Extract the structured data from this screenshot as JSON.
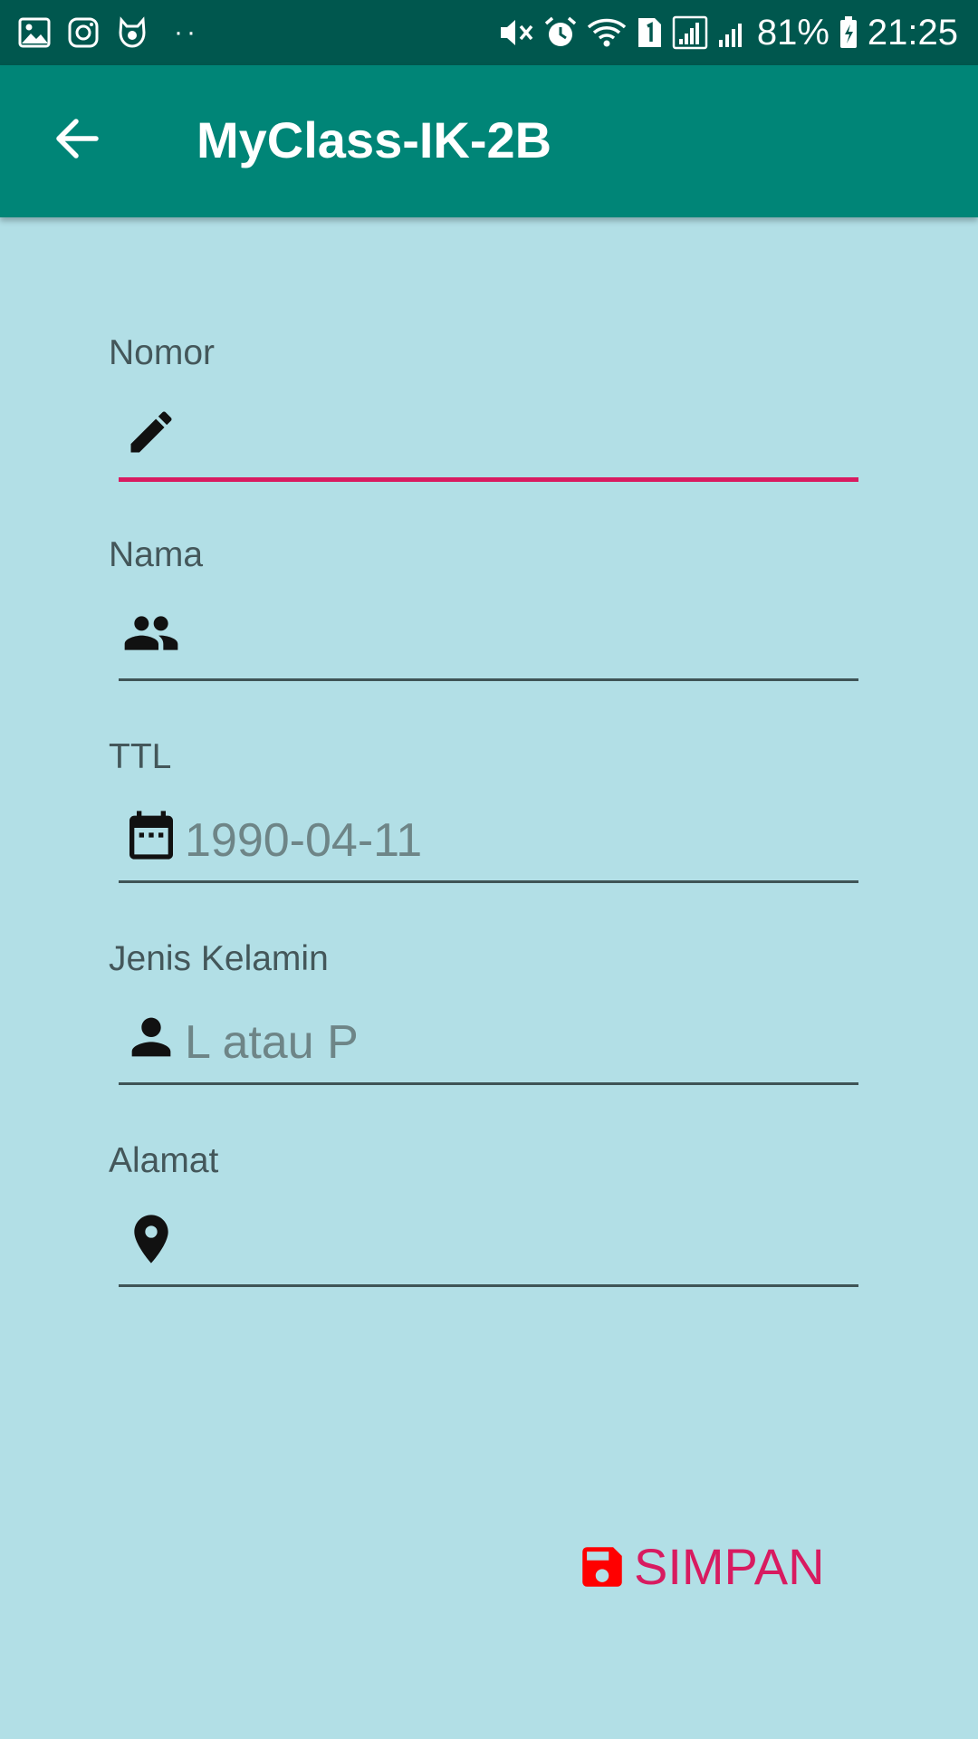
{
  "status_bar": {
    "left_icons": [
      "gallery-icon",
      "instagram-icon",
      "cat-app-icon"
    ],
    "dots": "··",
    "right_icons": [
      "mute-icon",
      "alarm-icon",
      "wifi-icon",
      "sim-1-icon",
      "signal-icon",
      "signal-icon-2",
      "battery-charging-icon"
    ],
    "battery_percent": "81%",
    "time": "21:25"
  },
  "app_bar": {
    "title": "MyClass-IK-2B",
    "background": "#008577",
    "back_icon": "arrow-back-icon"
  },
  "form": {
    "fields": [
      {
        "label": "Nomor",
        "icon": "pencil-icon",
        "value": "",
        "placeholder": "",
        "focused": true
      },
      {
        "label": "Nama",
        "icon": "people-icon",
        "value": "",
        "placeholder": ""
      },
      {
        "label": "TTL",
        "icon": "calendar-icon",
        "value": "",
        "placeholder": "1990-04-11"
      },
      {
        "label": "Jenis Kelamin",
        "icon": "person-icon",
        "value": "",
        "placeholder": "L atau P"
      },
      {
        "label": "Alamat",
        "icon": "location-pin-icon",
        "value": "",
        "placeholder": ""
      }
    ]
  },
  "save_button": {
    "label": "SIMPAN",
    "icon": "save-icon",
    "icon_color": "#ff0000",
    "text_color": "#d81b60"
  },
  "colors": {
    "background": "#b2dfe6",
    "status_bar": "#00574e",
    "accent": "#d81b60"
  }
}
